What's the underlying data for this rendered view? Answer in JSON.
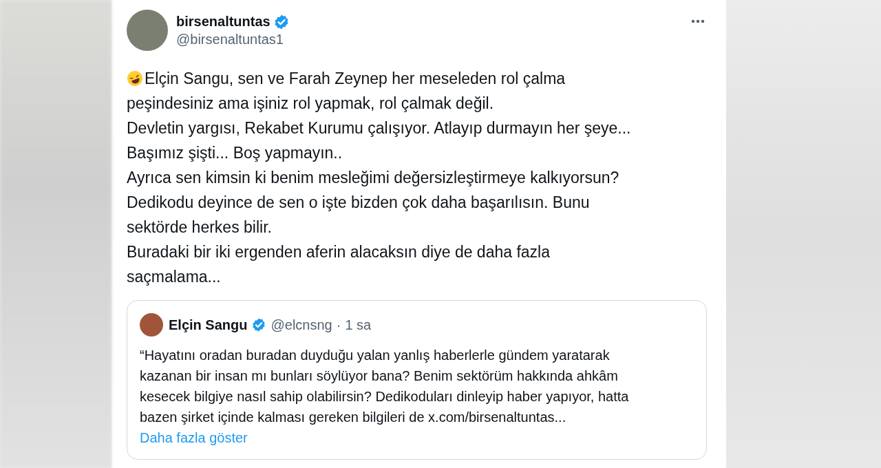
{
  "post": {
    "author": {
      "name": "birsenaltuntas",
      "handle": "@birsenaltuntas1",
      "verified": true
    },
    "lines": [
      "Elçin Sangu, sen ve Farah Zeynep her meseleden rol çalma",
      "peşindesiniz ama işiniz rol yapmak, rol çalmak değil.",
      "Devletin yargısı, Rekabet Kurumu çalışıyor. Atlayıp durmayın her şeye...",
      "Başımız şişti... Boş yapmayın..",
      "Ayrıca sen kimsin ki benim mesleğimi değersizleştirmeye kalkıyorsun?",
      "Dedikodu deyince de sen o işte bizden çok daha başarılısın. Bunu",
      "sektörde herkes bilir.",
      "Buradaki bir iki ergenden aferin alacaksın diye de daha fazla",
      "saçmalama..."
    ],
    "quoted": {
      "name": "Elçin Sangu",
      "verified": true,
      "handle": "@elcnsng",
      "separator": "·",
      "time": "1 sa",
      "lines": [
        "“Hayatını oradan buradan duyduğu yalan yanlış haberlerle gündem yaratarak",
        "kazanan bir insan mı bunları söylüyor bana? Benim sektörüm hakkında ahkâm",
        "kesecek bilgiye nasıl sahip olabilirsin? Dedikoduları dinleyip haber yapıyor, hatta",
        "bazen şirket içinde kalması gereken bilgileri de x.com/birsenaltuntas..."
      ],
      "show_more": "Daha fazla göster"
    }
  }
}
